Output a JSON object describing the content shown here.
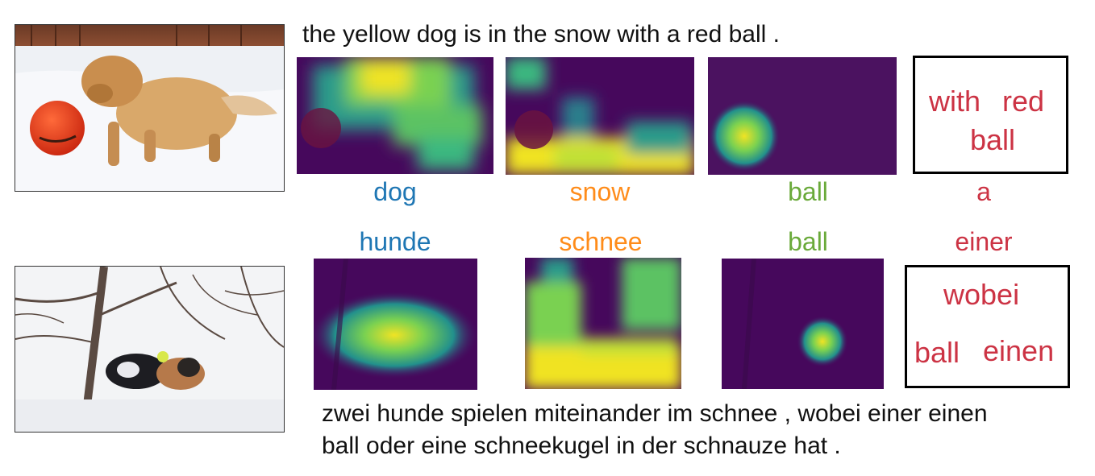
{
  "top": {
    "caption": "the yellow dog is in the snow with a red ball .",
    "words": [
      "dog",
      "snow",
      "ball",
      "a"
    ],
    "box_words": [
      "with",
      "red",
      "ball"
    ]
  },
  "bottom": {
    "caption_line1": "zwei hunde spielen miteinander im schnee , wobei einer einen",
    "caption_line2": "ball oder eine schneekugel in der schnauze hat .",
    "words": [
      "hunde",
      "schnee",
      "ball",
      "einer"
    ],
    "box_words": [
      "wobei",
      "ball",
      "einen"
    ]
  },
  "colors": {
    "word1": "#1f77b4",
    "word2": "#ff8c1a",
    "word3": "#6aaa3a",
    "word4": "#cc3344",
    "viridis_low": "#46085c",
    "viridis_high": "#f5e51c"
  }
}
